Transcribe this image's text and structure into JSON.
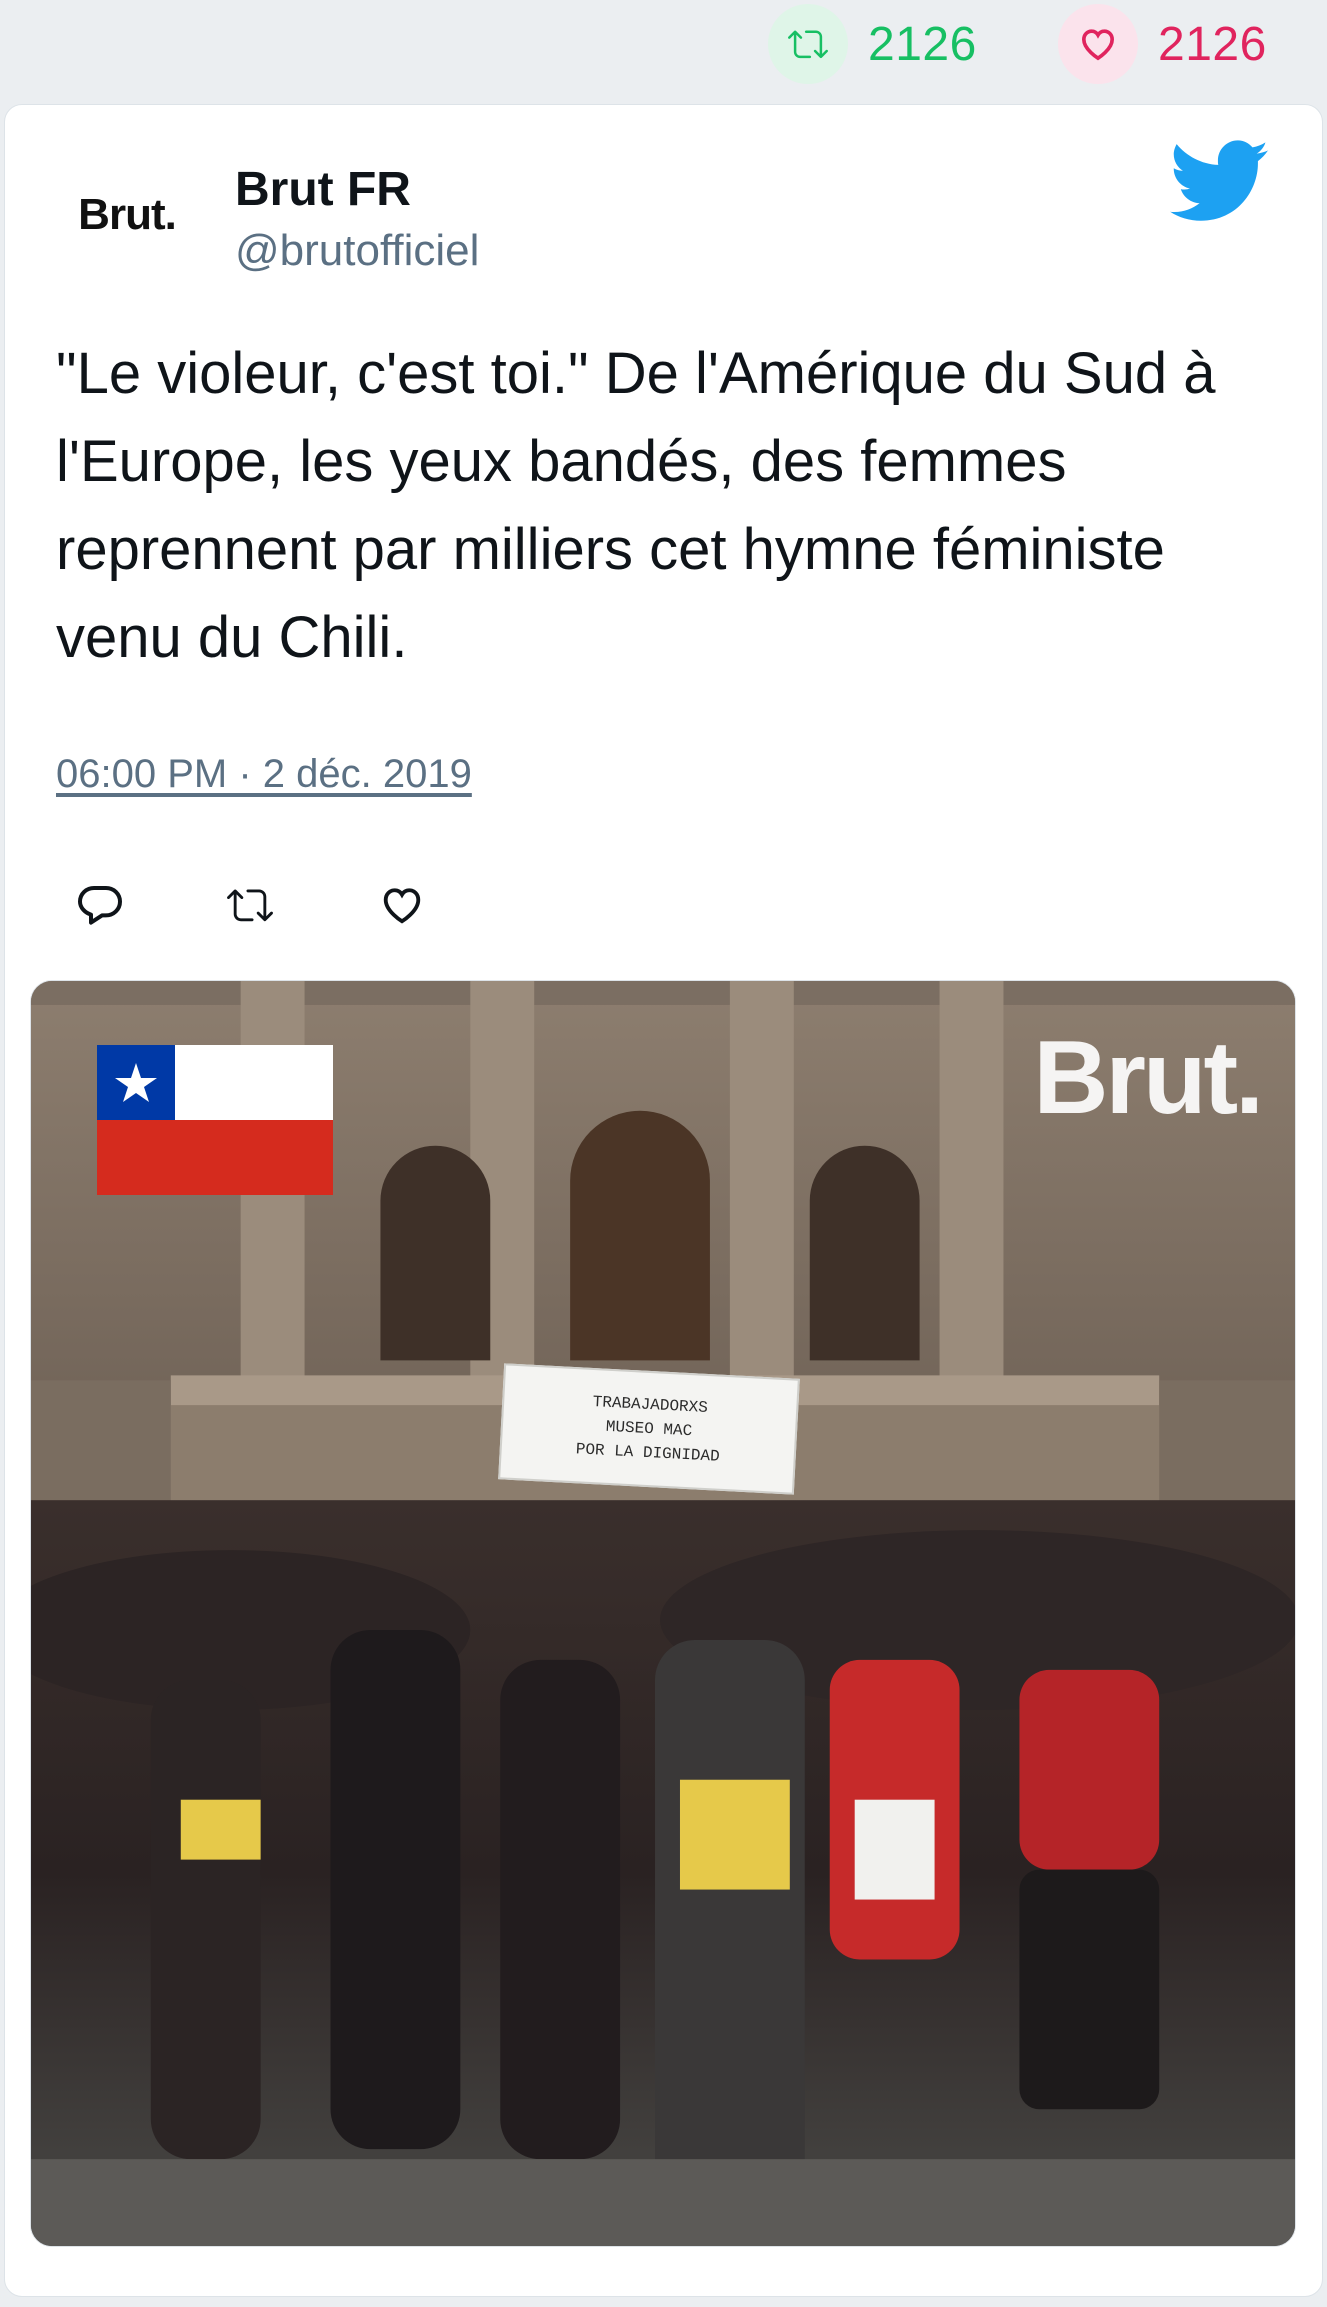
{
  "stats": {
    "retweet_count": "2126",
    "like_count": "2126"
  },
  "author": {
    "avatar_text": "Brut.",
    "name": "Brut FR",
    "handle": "@brutofficiel"
  },
  "tweet": {
    "text": "\"Le violeur, c'est toi.\" De l'Amérique du Sud à l'Europe, les yeux bandés, des femmes reprennent par milliers cet hymne féministe venu du Chili.",
    "timestamp": "06:00 PM · 2 déc. 2019"
  },
  "media": {
    "logo_text": "Brut.",
    "banner_lines": [
      "TRABAJADORXS",
      "MUSEO MAC",
      "POR LA DIGNIDAD"
    ]
  },
  "colors": {
    "retweet_green": "#17bf63",
    "like_red": "#e0245e",
    "twitter_blue": "#1da1f2",
    "secondary_text": "#5b7083"
  },
  "icons": {
    "retweet": "retweet-icon",
    "like": "heart-icon",
    "reply": "reply-icon",
    "brand": "twitter-bird-icon",
    "flag": "chile-flag-icon"
  }
}
